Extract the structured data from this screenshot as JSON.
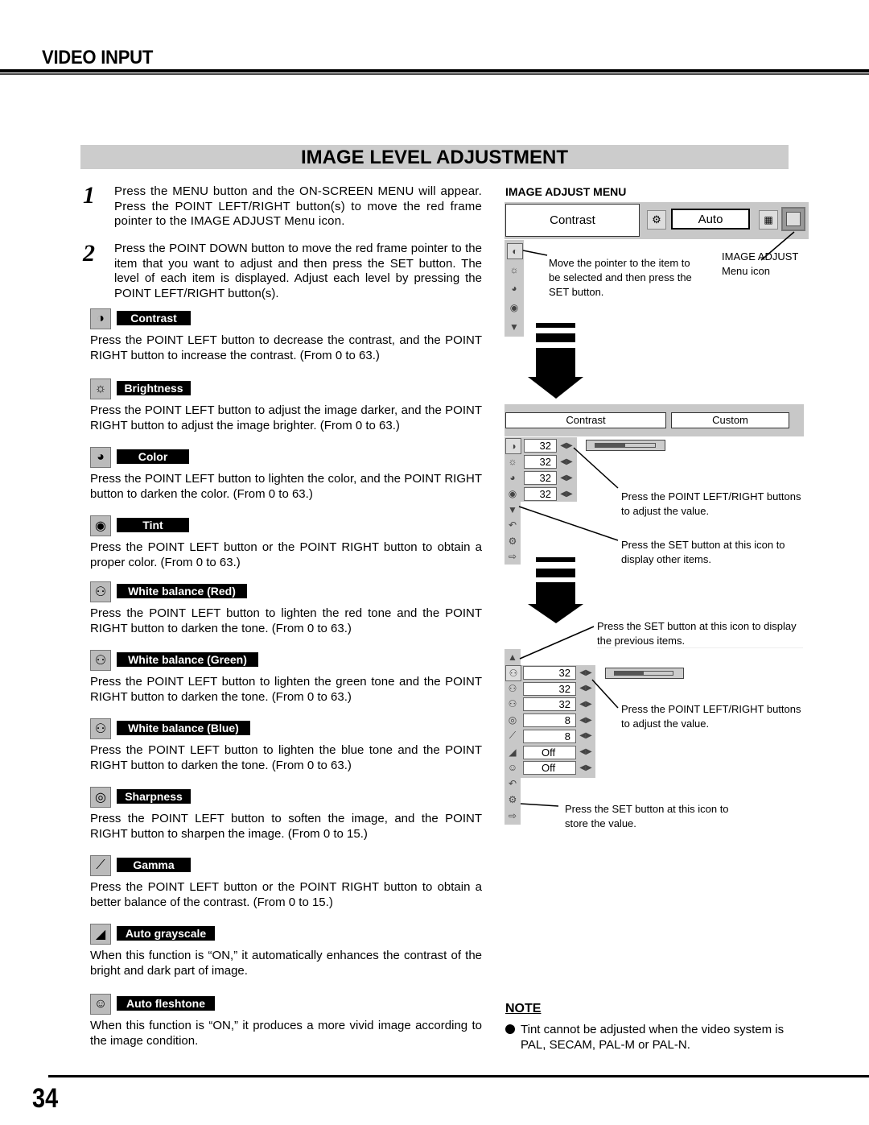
{
  "header": {
    "section": "VIDEO INPUT",
    "banner": "IMAGE LEVEL ADJUSTMENT"
  },
  "steps": [
    {
      "num": "1",
      "text": "Press the MENU button and the ON-SCREEN MENU will appear.  Press the POINT LEFT/RIGHT button(s) to move the red frame pointer to the IMAGE ADJUST Menu icon."
    },
    {
      "num": "2",
      "text": "Press the POINT DOWN button to move the red frame pointer to the item that you want to adjust and then press the SET button. The level of each item is displayed.  Adjust each level by pressing the POINT LEFT/RIGHT button(s)."
    }
  ],
  "items": [
    {
      "icon": "contrast-icon",
      "label": "Contrast",
      "desc": "Press the POINT LEFT button to decrease the contrast, and the POINT RIGHT button to increase the contrast.  (From 0 to 63.)"
    },
    {
      "icon": "brightness-icon",
      "label": "Brightness",
      "desc": "Press the POINT LEFT button to adjust the image darker, and the POINT RIGHT button to adjust the image brighter.  (From 0 to 63.)"
    },
    {
      "icon": "color-icon",
      "label": "Color",
      "desc": "Press the POINT LEFT button to lighten the color, and the POINT RIGHT button to darken the color.  (From 0 to 63.)"
    },
    {
      "icon": "tint-icon",
      "label": "Tint",
      "desc": "Press the POINT LEFT button or the POINT RIGHT button to obtain a proper color.  (From 0 to 63.)"
    },
    {
      "icon": "white-balance-red-icon",
      "label": "White balance (Red)",
      "desc": "Press the POINT LEFT button to lighten the red tone and the POINT RIGHT button to darken the tone.  (From 0 to 63.)"
    },
    {
      "icon": "white-balance-green-icon",
      "label": "White balance (Green)",
      "desc": "Press the POINT LEFT button to lighten the green tone and the POINT RIGHT button to darken the tone.  (From 0 to 63.)"
    },
    {
      "icon": "white-balance-blue-icon",
      "label": "White balance (Blue)",
      "desc": "Press the POINT LEFT button to lighten the blue tone and the POINT RIGHT button to darken the tone.  (From 0 to 63.)"
    },
    {
      "icon": "sharpness-icon",
      "label": "Sharpness",
      "desc": "Press the POINT LEFT button to soften the image, and the POINT RIGHT button to sharpen the image.  (From 0 to 15.)"
    },
    {
      "icon": "gamma-icon",
      "label": "Gamma",
      "desc": "Press the POINT LEFT button or the POINT RIGHT button to obtain a better balance of the contrast.  (From 0 to 15.)"
    },
    {
      "icon": "auto-grayscale-icon",
      "label": "Auto grayscale",
      "desc": "When this function is “ON,” it automatically enhances the contrast of the bright and dark part of image."
    },
    {
      "icon": "auto-fleshtone-icon",
      "label": "Auto fleshtone",
      "desc": "When this function is “ON,” it produces a more vivid image according to the image condition."
    }
  ],
  "menu": {
    "heading": "IMAGE ADJUST MENU",
    "top_label": "Contrast",
    "top_mode": "Auto",
    "callout_pointer": "Move the pointer to the item to be selected and then press the SET button.",
    "callout_menu_icon": "IMAGE ADJUST Menu icon",
    "panel2_label": "Contrast",
    "panel2_mode": "Custom",
    "panel2_values": [
      "32",
      "32",
      "32",
      "32"
    ],
    "panel2_slider_fraction": 0.5,
    "callout_adjust_1": "Press the POINT LEFT/RIGHT buttons to adjust the value.",
    "callout_other_items": "Press the SET button at this icon to display other items.",
    "callout_previous_items": "Press the SET button at this icon to display the previous items.",
    "panel3_values": [
      "32",
      "32",
      "32",
      "8",
      "8",
      "Off",
      "Off"
    ],
    "panel3_slider_fraction": 0.5,
    "callout_adjust_2": "Press the POINT LEFT/RIGHT buttons to adjust the value.",
    "callout_store": "Press the SET button at this icon to store the value."
  },
  "note": {
    "title": "NOTE",
    "text": "Tint cannot be adjusted when the video system is PAL, SECAM, PAL-M or PAL-N."
  },
  "footer": {
    "page": "34"
  }
}
